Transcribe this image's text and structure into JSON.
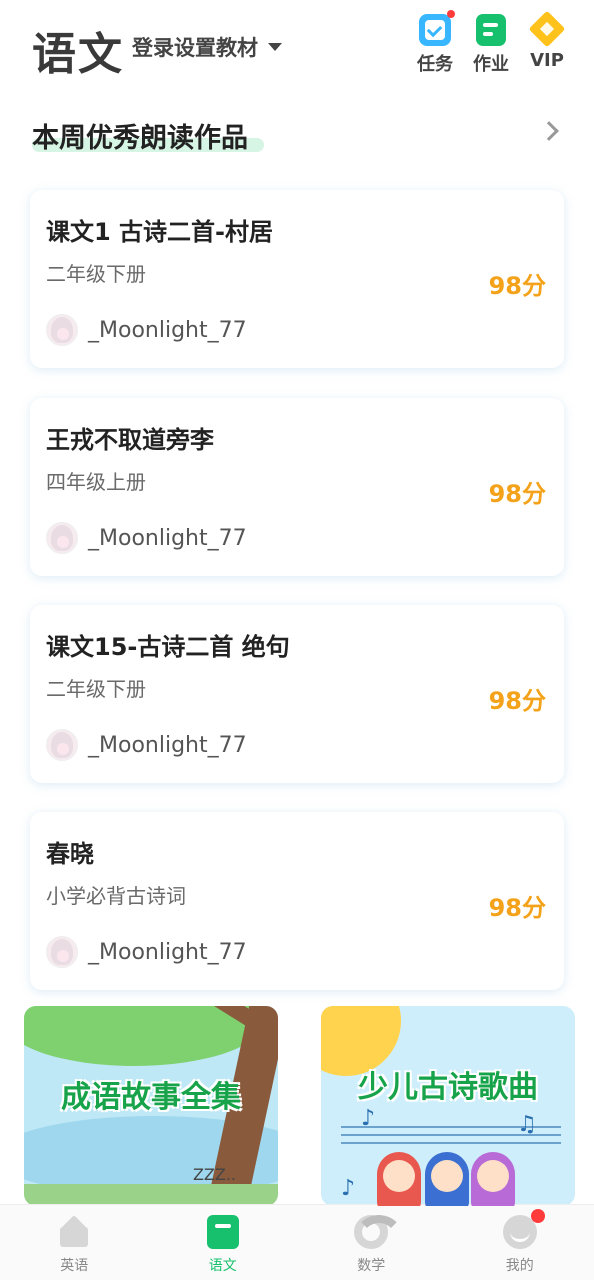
{
  "header": {
    "subject": "语文",
    "textbook_select": "登录设置教材",
    "actions": [
      {
        "label": "任务",
        "icon": "task-check-icon"
      },
      {
        "label": "作业",
        "icon": "homework-icon"
      },
      {
        "label": "VIP",
        "icon": "vip-diamond-icon"
      }
    ]
  },
  "section": {
    "title": "本周优秀朗读作品"
  },
  "works": [
    {
      "title": "课文1 古诗二首-村居",
      "grade": "二年级下册",
      "score": "98分",
      "user": "_Moonlight_77"
    },
    {
      "title": "王戎不取道旁李",
      "grade": "四年级上册",
      "score": "98分",
      "user": "_Moonlight_77"
    },
    {
      "title": "课文15-古诗二首 绝句",
      "grade": "二年级下册",
      "score": "98分",
      "user": "_Moonlight_77"
    },
    {
      "title": "春晓",
      "grade": "小学必背古诗词",
      "score": "98分",
      "user": "_Moonlight_77"
    }
  ],
  "banners": [
    {
      "title": "成语故事全集",
      "zzz": "ZZZ.."
    },
    {
      "title": "少儿古诗歌曲"
    }
  ],
  "bottom_nav": [
    {
      "label": "英语",
      "icon": "house-icon",
      "active": false
    },
    {
      "label": "语文",
      "icon": "book-icon",
      "active": true
    },
    {
      "label": "数学",
      "icon": "donut-icon",
      "active": false
    },
    {
      "label": "我的",
      "icon": "profile-icon",
      "active": false
    }
  ],
  "colors": {
    "accent_green": "#16c06c",
    "score_orange": "#f4a21a",
    "task_blue": "#38b6ff",
    "vip_gold": "#ffc21a",
    "badge_red": "#ff3b3b"
  }
}
